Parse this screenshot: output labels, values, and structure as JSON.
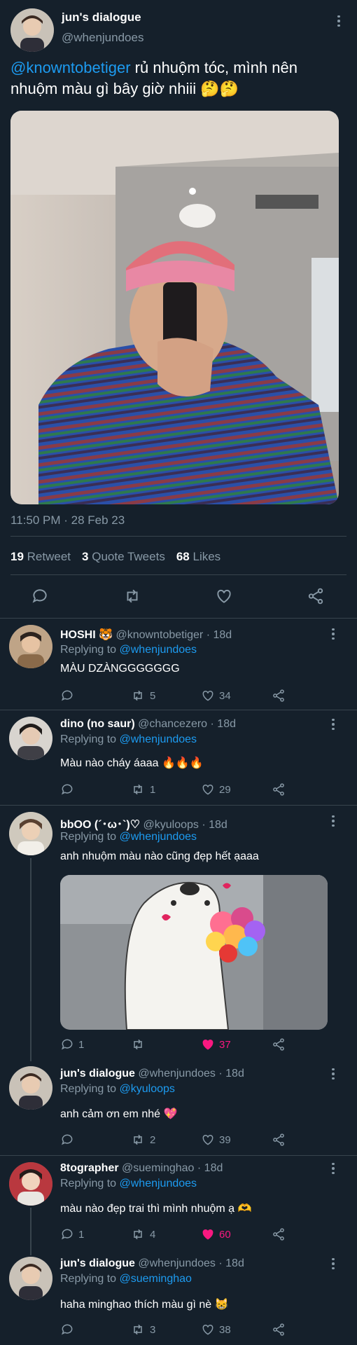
{
  "main_tweet": {
    "author_name": "jun's dialogue",
    "handle": "@whenjundoes",
    "mention": "@knowntobetiger",
    "text": " rủ nhuộm tóc, mình nên nhuộm màu gì bây giờ nhiii 🤔🤔",
    "timestamp": "11:50 PM · 28 Feb 23",
    "retweets_count": "19",
    "retweets_label": "Retweet",
    "quotes_count": "3",
    "quotes_label": "Quote Tweets",
    "likes_count": "68",
    "likes_label": "Likes"
  },
  "replies": [
    {
      "name": "HOSHI 🐯",
      "handle": "@knowntobetiger",
      "time": "· 18d",
      "replying_label": "Replying to ",
      "replying_to": "@whenjundoes",
      "text": "MÀU DZÀNGGGGGGG",
      "reply_count": "",
      "retweet_count": "5",
      "like_count": "34"
    },
    {
      "name": "dino (no saur)",
      "handle": "@chancezero",
      "time": "· 18d",
      "replying_label": "Replying to ",
      "replying_to": "@whenjundoes",
      "text": "Màu nào cháy áaaa 🔥🔥🔥",
      "reply_count": "",
      "retweet_count": "1",
      "like_count": "29"
    },
    {
      "name": "bbOO (´･ω･`)♡",
      "handle": "@kyuloops",
      "time": "· 18d",
      "replying_label": "Replying to ",
      "replying_to": "@whenjundoes",
      "text": "anh nhuộm màu nào cũng đẹp hết ạaaa",
      "reply_count": "1",
      "retweet_count": "",
      "like_count": "37"
    },
    {
      "name": "jun's dialogue",
      "handle": "@whenjundoes",
      "time": "· 18d",
      "replying_label": "Replying to ",
      "replying_to": "@kyuloops",
      "text": "anh cảm ơn em nhé 💖",
      "reply_count": "",
      "retweet_count": "2",
      "like_count": "39"
    },
    {
      "name": "8tographer",
      "handle": "@sueminghao",
      "time": "· 18d",
      "replying_label": "Replying to ",
      "replying_to": "@whenjundoes",
      "text": "màu nào đẹp trai thì mình nhuộm ạ 🫶",
      "reply_count": "1",
      "retweet_count": "4",
      "like_count": "60"
    },
    {
      "name": "jun's dialogue",
      "handle": "@whenjundoes",
      "time": "· 18d",
      "replying_label": "Replying to ",
      "replying_to": "@sueminghao",
      "text": "haha minghao thích màu gì nè 😸",
      "reply_count": "",
      "retweet_count": "3",
      "like_count": "38"
    }
  ],
  "colors": {
    "background": "#15202b",
    "muted_text": "#8899a6",
    "link": "#1d9bf0",
    "liked": "#f91880",
    "divider": "#38444d"
  }
}
